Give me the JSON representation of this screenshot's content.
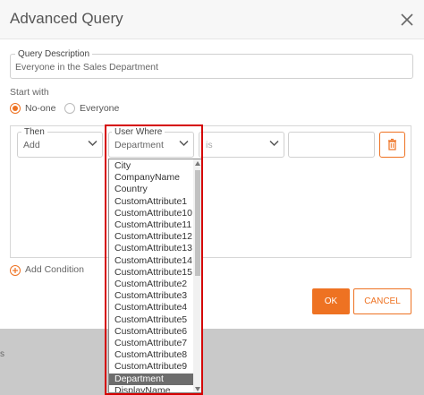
{
  "dialog": {
    "title": "Advanced Query",
    "close_icon": "close-icon"
  },
  "query_description": {
    "label": "Query Description",
    "value": "Everyone in the Sales Department"
  },
  "start_with": {
    "label": "Start with",
    "options": [
      {
        "label": "No-one",
        "selected": true
      },
      {
        "label": "Everyone",
        "selected": false
      }
    ]
  },
  "condition": {
    "then_label": "Then",
    "then_value": "Add",
    "user_where_label": "User Where",
    "user_where_value": "Department",
    "operator_value": "is",
    "value": "",
    "delete_icon": "trash-icon"
  },
  "dropdown": {
    "items": [
      "City",
      "CompanyName",
      "Country",
      "CustomAttribute1",
      "CustomAttribute10",
      "CustomAttribute11",
      "CustomAttribute12",
      "CustomAttribute13",
      "CustomAttribute14",
      "CustomAttribute15",
      "CustomAttribute2",
      "CustomAttribute3",
      "CustomAttribute4",
      "CustomAttribute5",
      "CustomAttribute6",
      "CustomAttribute7",
      "CustomAttribute8",
      "CustomAttribute9",
      "Department",
      "DisplayName"
    ],
    "selected": "Department"
  },
  "add_condition_label": "Add Condition",
  "buttons": {
    "ok": "OK",
    "cancel": "CANCEL"
  },
  "backdrop_label": "s",
  "colors": {
    "accent": "#ee7222",
    "highlight": "#d50000",
    "selected_item": "#6d6d6d"
  }
}
